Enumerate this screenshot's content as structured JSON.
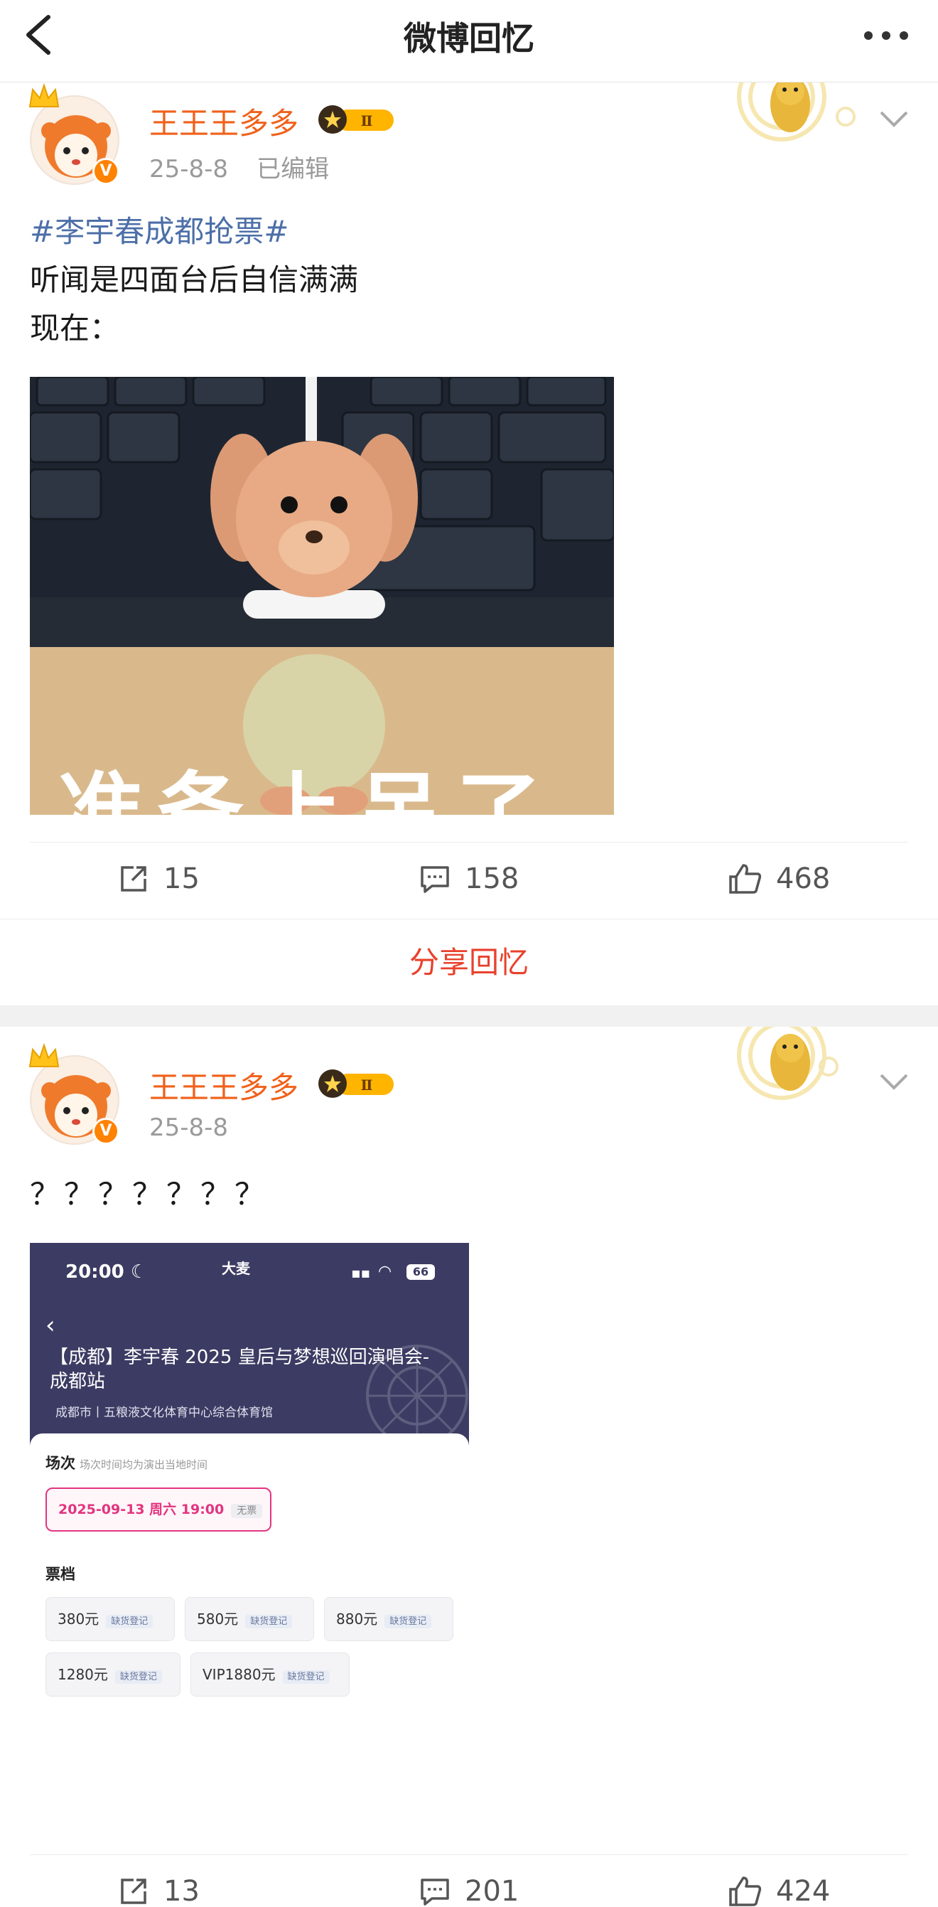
{
  "nav": {
    "title": "微博回忆"
  },
  "posts": [
    {
      "username": "王王王多多",
      "date": "25-8-8",
      "edited": "已编辑",
      "hashtag": "#李宇春成都抢票#",
      "lines": [
        "听闻是四面台后自信满满",
        "现在："
      ],
      "image_caption": "准备上吊了",
      "actions": {
        "repost": "15",
        "comment": "158",
        "like": "468"
      }
    },
    {
      "username": "王王王多多",
      "date": "25-8-8",
      "text": "？？？？？？？",
      "screenshot": {
        "time": "20:00",
        "app": "大麦",
        "battery": "66",
        "title": "【成都】李宇春 2025 皇后与梦想巡回演唱会-成都站",
        "venue": "成都市丨五粮液文化体育中心综合体育馆",
        "session_label": "场次",
        "session_note": "场次时间均为演出当地时间",
        "session_date": "2025-09-13 周六 19:00",
        "session_tag": "无票",
        "tiers_label": "票档",
        "tiers": [
          {
            "price": "380元",
            "tag": "缺货登记"
          },
          {
            "price": "580元",
            "tag": "缺货登记"
          },
          {
            "price": "880元",
            "tag": "缺货登记"
          },
          {
            "price": "1280元",
            "tag": "缺货登记"
          },
          {
            "price": "VIP1880元",
            "tag": "缺货登记"
          }
        ]
      },
      "actions": {
        "repost": "13",
        "comment": "201",
        "like": "424"
      }
    }
  ],
  "share": {
    "label": "分享回忆"
  },
  "colors": {
    "username": "#f0611a",
    "hashtag": "#4d6fa8",
    "share": "#e8412c",
    "v_badge": "#ff8200",
    "screenshot_header": "#3b3b63",
    "date_pink": "#e2357f"
  },
  "icons": [
    "back-arrow-icon",
    "more-dots-icon",
    "crown-icon",
    "verified-icon",
    "vip-level-icon",
    "chevron-down-icon",
    "repost-icon",
    "comment-icon",
    "like-icon"
  ]
}
